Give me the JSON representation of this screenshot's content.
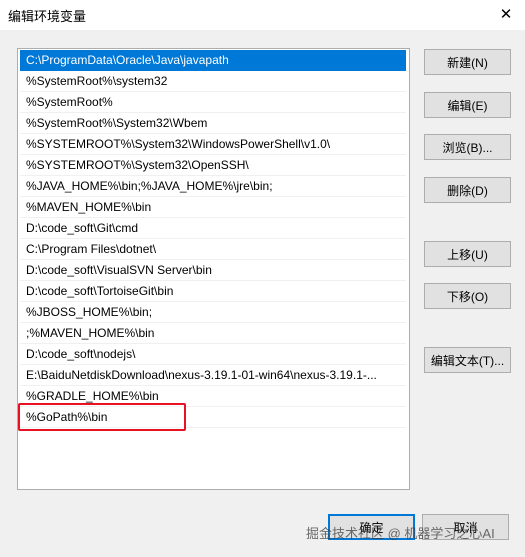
{
  "window": {
    "title": "编辑环境变量",
    "close_glyph": "✕"
  },
  "path_list": [
    "C:\\ProgramData\\Oracle\\Java\\javapath",
    "%SystemRoot%\\system32",
    "%SystemRoot%",
    "%SystemRoot%\\System32\\Wbem",
    "%SYSTEMROOT%\\System32\\WindowsPowerShell\\v1.0\\",
    "%SYSTEMROOT%\\System32\\OpenSSH\\",
    "%JAVA_HOME%\\bin;%JAVA_HOME%\\jre\\bin;",
    "%MAVEN_HOME%\\bin",
    "D:\\code_soft\\Git\\cmd",
    "C:\\Program Files\\dotnet\\",
    "D:\\code_soft\\VisualSVN Server\\bin",
    "D:\\code_soft\\TortoiseGit\\bin",
    "%JBOSS_HOME%\\bin;",
    ";%MAVEN_HOME%\\bin",
    "D:\\code_soft\\nodejs\\",
    "E:\\BaiduNetdiskDownload\\nexus-3.19.1-01-win64\\nexus-3.19.1-...",
    "%GRADLE_HOME%\\bin",
    "%GoPath%\\bin"
  ],
  "selected_index": 0,
  "side_buttons": {
    "new": "新建(N)",
    "edit": "编辑(E)",
    "browse": "浏览(B)...",
    "delete": "删除(D)",
    "move_up": "上移(U)",
    "move_down": "下移(O)",
    "edit_text": "编辑文本(T)..."
  },
  "footer": {
    "ok": "确定",
    "cancel": "取消"
  },
  "watermark": "掘金技术社区 @ 机器学习之心AI",
  "colors": {
    "selection": "#0078d7",
    "annotation_box": "#e81123",
    "dialog_bg": "#f0f0f0"
  }
}
